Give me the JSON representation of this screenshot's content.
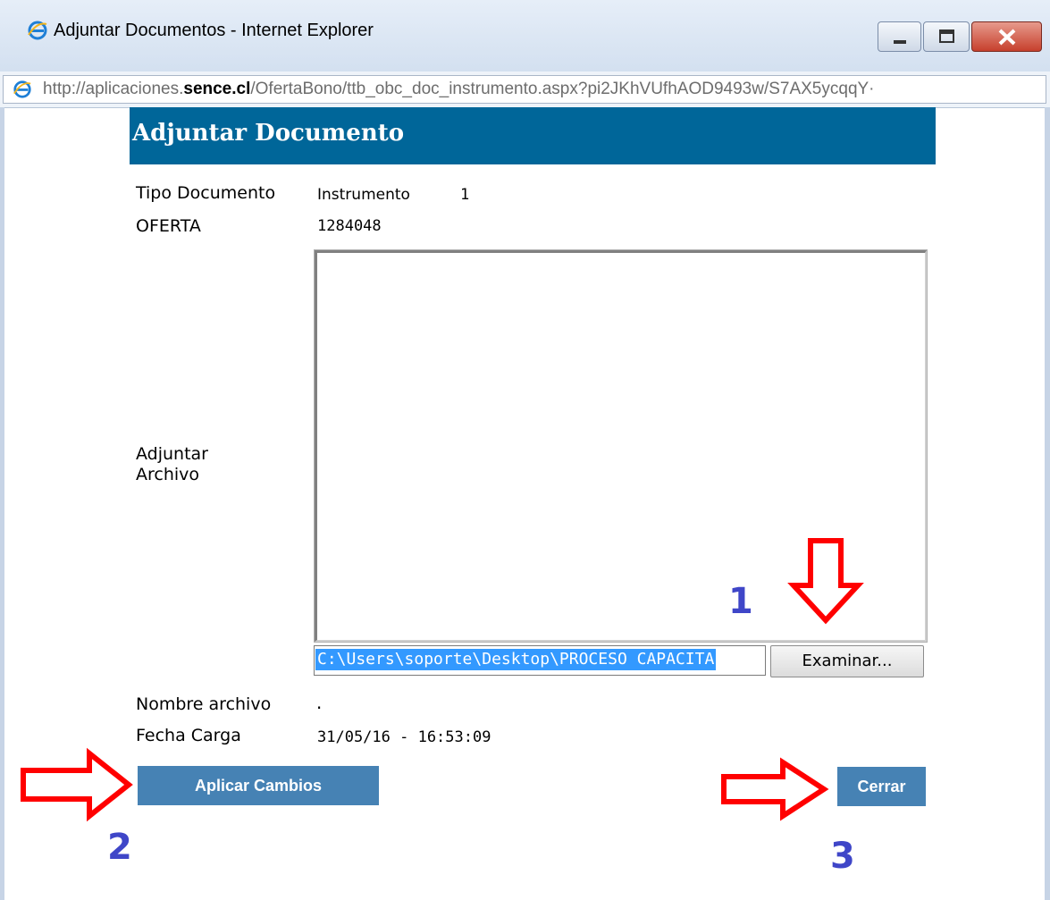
{
  "window": {
    "title": "Adjuntar Documentos - Internet Explorer",
    "url_prefix": "http://aplicaciones.",
    "url_domain": "sence.cl",
    "url_rest": "/OfertaBono/ttb_obc_doc_instrumento.aspx?pi2JKhVUfhAOD9493w/S7AX5ycqqY·"
  },
  "form": {
    "heading": "Adjuntar Documento",
    "tipo_label": "Tipo Documento",
    "tipo_value": "Instrumento",
    "tipo_number": "1",
    "oferta_label": "OFERTA",
    "oferta_value": "1284048",
    "adjuntar_label_line1": "Adjuntar",
    "adjuntar_label_line2": "Archivo",
    "file_path": "C:\\Users\\soporte\\Desktop\\PROCESO CAPACITA",
    "browse_label": "Examinar...",
    "nombre_label": "Nombre archivo",
    "nombre_value": ".",
    "fecha_label": "Fecha Carga",
    "fecha_value": "31/05/16 - 16:53:09",
    "apply_label": "Aplicar Cambios",
    "close_label": "Cerrar"
  },
  "annotations": {
    "step1": "1",
    "step2": "2",
    "step3": "3",
    "color": "#3f46c8",
    "arrow_color": "#ff0000"
  },
  "colors": {
    "header_bg": "#006699",
    "button_bg": "#4682b4"
  }
}
